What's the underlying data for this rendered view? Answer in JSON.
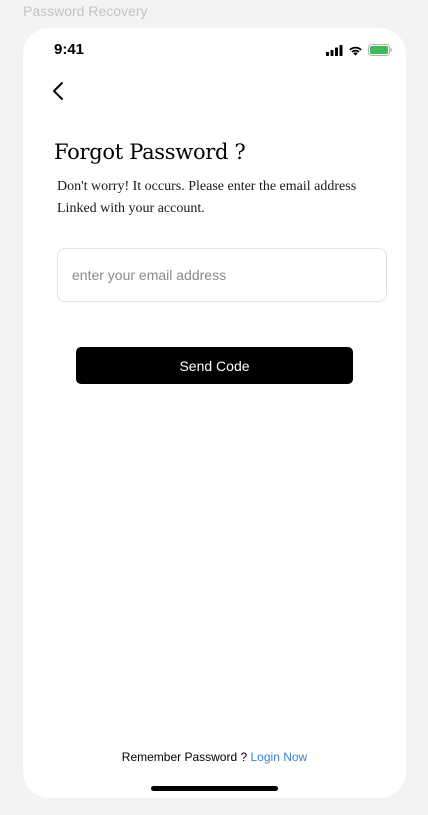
{
  "frame": {
    "label": "Password Recovery"
  },
  "status_bar": {
    "time": "9:41",
    "icons": [
      "cellular-signal-icon",
      "wifi-icon",
      "battery-icon"
    ],
    "battery_color": "#3dbb5a"
  },
  "header": {
    "back_icon": "chevron-left-icon",
    "title": "Forgot Password ?"
  },
  "content": {
    "subtitle_line1": "Don't worry! It occurs. Please enter the email address",
    "subtitle_line2": "Linked with your account.",
    "email_placeholder": "enter your email address",
    "email_value": "",
    "send_button_label": "Send Code"
  },
  "footer": {
    "prompt": "Remember Password ? ",
    "link_label": "Login Now",
    "link_color": "#3b82d6"
  },
  "colors": {
    "background": "#f3f3f3",
    "card": "#ffffff",
    "button": "#000000"
  }
}
